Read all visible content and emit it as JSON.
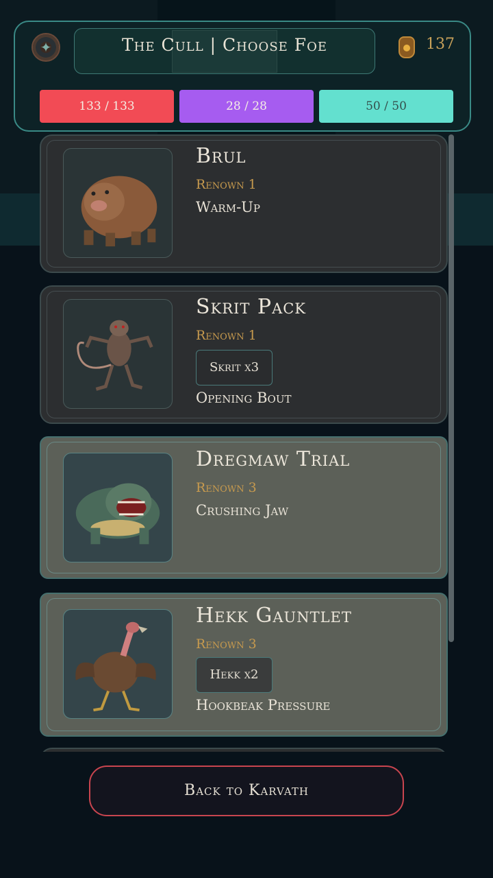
{
  "header": {
    "title": "The Cull | Choose Foe",
    "currency": "137",
    "stats": {
      "health": "133 / 133",
      "mana": "28 / 28",
      "stamina": "50 / 50"
    }
  },
  "foes": [
    {
      "name": "Brul",
      "renown": "Renown 1",
      "tag": "",
      "description": "Warm-Up",
      "icon": "mole-beast-icon"
    },
    {
      "name": "Skrit Pack",
      "renown": "Renown 1",
      "tag": "Skrit x3",
      "description": "Opening Bout",
      "icon": "rat-creature-icon"
    },
    {
      "name": "Dregmaw Trial",
      "renown": "Renown 3",
      "tag": "",
      "description": "Crushing Jaw",
      "icon": "toad-beast-icon"
    },
    {
      "name": "Hekk Gauntlet",
      "renown": "Renown 3",
      "tag": "Hekk x2",
      "description": "Hookbeak Pressure",
      "icon": "vulture-creature-icon"
    }
  ],
  "back_button": "Back to Karvath",
  "colors": {
    "health": "#f24b55",
    "mana": "#a65cf0",
    "stamina": "#63e0cf",
    "accent": "#3a8a86",
    "renown": "#c79a4e",
    "back_border": "#c9454f"
  }
}
